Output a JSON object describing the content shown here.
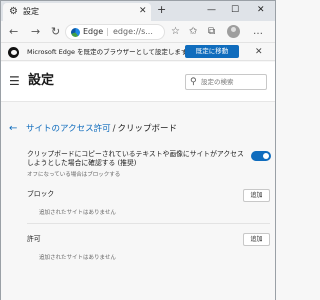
{
  "browser": {
    "tab_title": "設定",
    "tab_close": "✕",
    "new_tab": "+",
    "window_controls": [
      "—",
      "☐",
      "✕"
    ],
    "address_edge_label": "Edge",
    "address_separator": "|",
    "address_url": "edge://s...",
    "more": "…",
    "icons": [
      "gear-icon",
      "close-icon",
      "back-icon",
      "forward-icon",
      "refresh-icon",
      "star-icon",
      "collections-icon",
      "profile-icon",
      "more-icon"
    ]
  },
  "infobar": {
    "message": "Microsoft Edge を既定のブラウザーとして設定しますか？",
    "button": "既定に移動",
    "close": "✕"
  },
  "header": {
    "menu": "☰",
    "title": "設定",
    "search_placeholder": "設定の検索"
  },
  "content": {
    "back": "←",
    "breadcrumb_link": "サイトのアクセス許可",
    "breadcrumb_sep": "/",
    "breadcrumb_current": "クリップボード",
    "ask_label": "クリップボードにコピーされているテキストや画像にサイトがアクセスしようとした場合に確認する (推奨)",
    "ask_sublabel": "オフになっている場合はブロックする",
    "toggle_on": true,
    "block": {
      "title": "ブロック",
      "add": "追加",
      "empty": "追加されたサイトはありません"
    },
    "allow": {
      "title": "許可",
      "add": "追加",
      "empty": "追加されたサイトはありません"
    }
  },
  "colors": {
    "accent": "#0f6cbd",
    "background": "#f7f7f7"
  }
}
